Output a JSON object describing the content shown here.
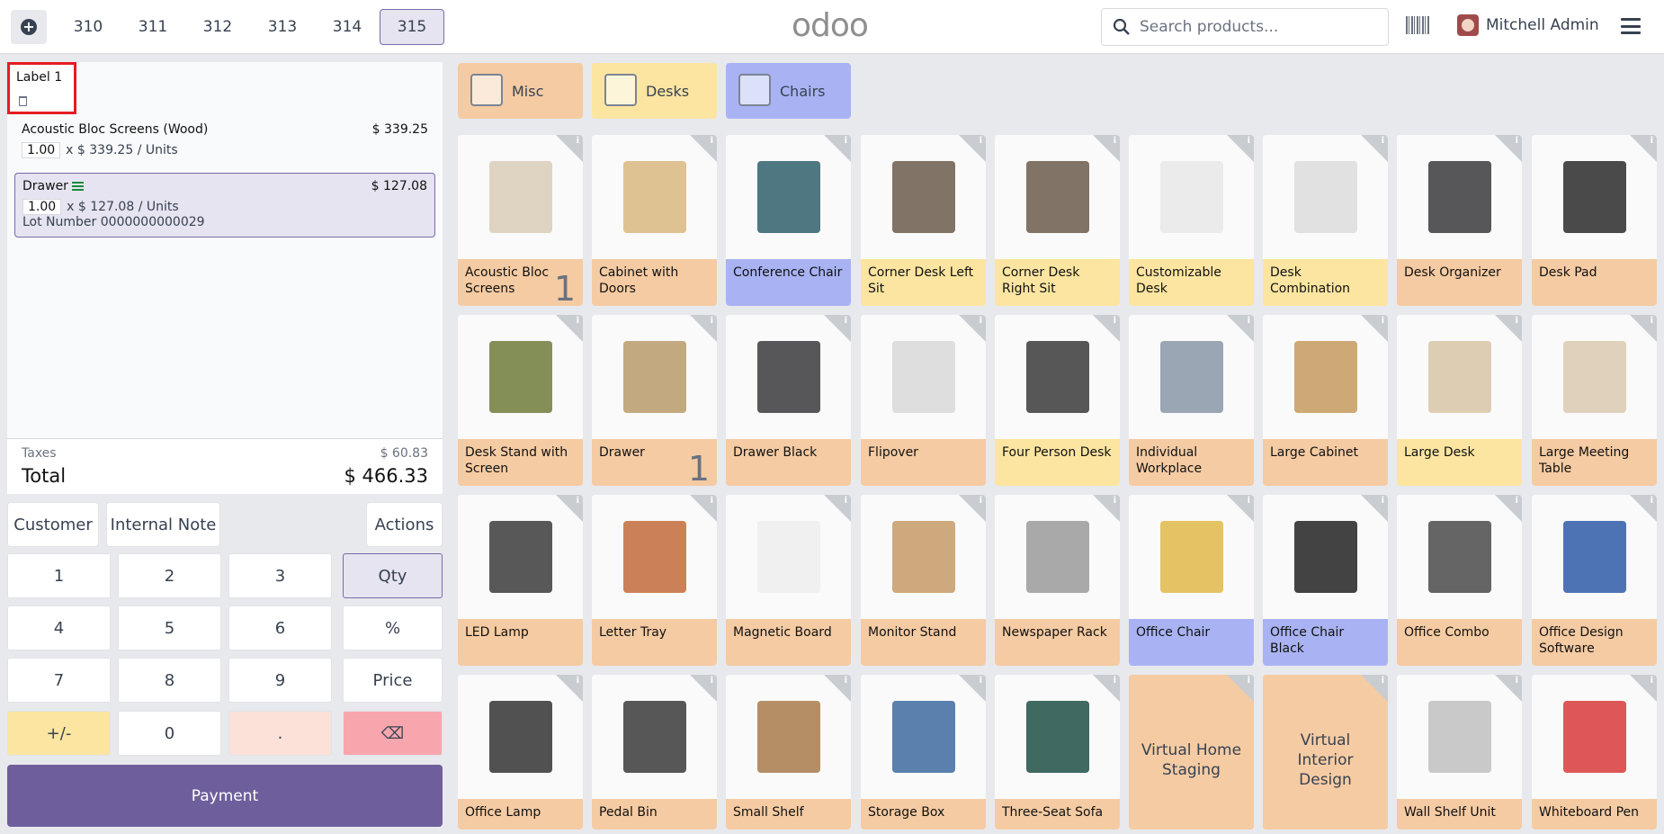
{
  "header": {
    "tabs": [
      "310",
      "311",
      "312",
      "313",
      "314",
      "315"
    ],
    "active_tab": "315",
    "logo": "odoo",
    "search_placeholder": "Search products...",
    "user_name": "Mitchell Admin"
  },
  "order": {
    "label": "Label 1",
    "lines": [
      {
        "name": "Acoustic Bloc Screens (Wood)",
        "price": "$ 339.25",
        "qty": "1.00",
        "unit": "x $ 339.25 / Units"
      },
      {
        "name": "Drawer",
        "price": "$ 127.08",
        "qty": "1.00",
        "unit": "x $ 127.08 / Units",
        "lot": "Lot Number 0000000000029"
      }
    ],
    "taxes_label": "Taxes",
    "taxes_value": "$ 60.83",
    "total_label": "Total",
    "total_value": "$ 466.33"
  },
  "controls": {
    "customer": "Customer",
    "internal_note": "Internal Note",
    "actions": "Actions",
    "keys": [
      "1",
      "2",
      "3",
      "Qty",
      "4",
      "5",
      "6",
      "%",
      "7",
      "8",
      "9",
      "Price",
      "+/-",
      "0",
      ".",
      "⌫"
    ],
    "payment": "Payment"
  },
  "categories": [
    {
      "label": "Misc",
      "color": "#f5cba3"
    },
    {
      "label": "Desks",
      "color": "#fbe5a0"
    },
    {
      "label": "Chairs",
      "color": "#a9b3f3"
    }
  ],
  "products": [
    {
      "name": "Acoustic Bloc Screens",
      "color": "#f5cba3",
      "qty": "1"
    },
    {
      "name": "Cabinet with Doors",
      "color": "#f5cba3"
    },
    {
      "name": "Conference Chair",
      "color": "#a9b3f3"
    },
    {
      "name": "Corner Desk Left Sit",
      "color": "#fbe5a0"
    },
    {
      "name": "Corner Desk Right Sit",
      "color": "#fbe5a0"
    },
    {
      "name": "Customizable Desk",
      "color": "#fbe5a0"
    },
    {
      "name": "Desk Combination",
      "color": "#fbe5a0"
    },
    {
      "name": "Desk Organizer",
      "color": "#f5cba3"
    },
    {
      "name": "Desk Pad",
      "color": "#f5cba3"
    },
    {
      "name": "Desk Stand with Screen",
      "color": "#f5cba3"
    },
    {
      "name": "Drawer",
      "color": "#f5cba3",
      "qty": "1"
    },
    {
      "name": "Drawer Black",
      "color": "#f5cba3"
    },
    {
      "name": "Flipover",
      "color": "#f5cba3"
    },
    {
      "name": "Four Person Desk",
      "color": "#fbe5a0"
    },
    {
      "name": "Individual Workplace",
      "color": "#f5cba3"
    },
    {
      "name": "Large Cabinet",
      "color": "#f5cba3"
    },
    {
      "name": "Large Desk",
      "color": "#fbe5a0"
    },
    {
      "name": "Large Meeting Table",
      "color": "#f5cba3"
    },
    {
      "name": "LED Lamp",
      "color": "#f5cba3"
    },
    {
      "name": "Letter Tray",
      "color": "#f5cba3"
    },
    {
      "name": "Magnetic Board",
      "color": "#f5cba3"
    },
    {
      "name": "Monitor Stand",
      "color": "#f5cba3"
    },
    {
      "name": "Newspaper Rack",
      "color": "#f5cba3"
    },
    {
      "name": "Office Chair",
      "color": "#a9b3f3"
    },
    {
      "name": "Office Chair Black",
      "color": "#a9b3f3"
    },
    {
      "name": "Office Combo",
      "color": "#f5cba3"
    },
    {
      "name": "Office Design Software",
      "color": "#f5cba3"
    },
    {
      "name": "Office Lamp",
      "color": "#f5cba3"
    },
    {
      "name": "Pedal Bin",
      "color": "#f5cba3"
    },
    {
      "name": "Small Shelf",
      "color": "#f5cba3"
    },
    {
      "name": "Storage Box",
      "color": "#f5cba3"
    },
    {
      "name": "Three-Seat Sofa",
      "color": "#f5cba3"
    },
    {
      "name": "Virtual Home Staging",
      "color": "#f5cba3",
      "text_only": true
    },
    {
      "name": "Virtual Interior Design",
      "color": "#f5cba3",
      "text_only": true
    },
    {
      "name": "Wall Shelf Unit",
      "color": "#f5cba3"
    },
    {
      "name": "Whiteboard Pen",
      "color": "#f5cba3"
    }
  ],
  "info_glyph": "i",
  "trash_icon": "trash-icon"
}
